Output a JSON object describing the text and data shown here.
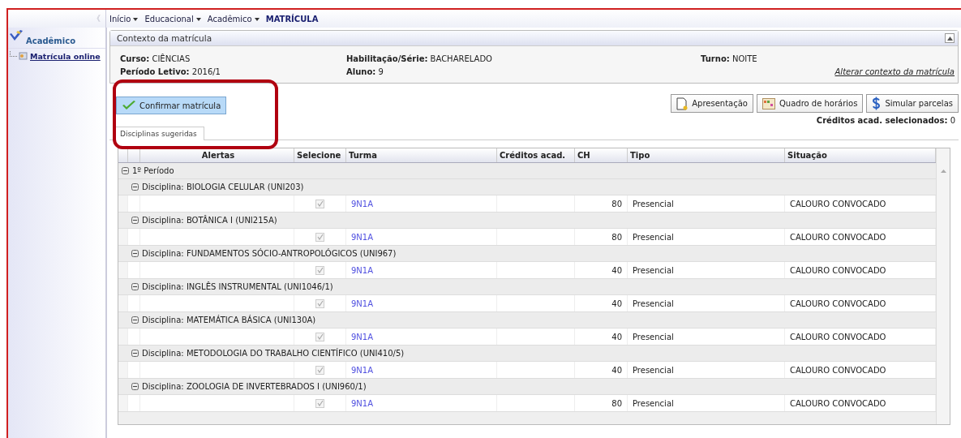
{
  "breadcrumb": [
    {
      "label": "Início",
      "dropdown": true
    },
    {
      "label": "Educacional",
      "dropdown": true
    },
    {
      "label": "Acadêmico",
      "dropdown": true
    },
    {
      "label": "MATRÍCULA",
      "dropdown": false
    }
  ],
  "sidebar": {
    "collapse": "《",
    "title": "Acadêmico",
    "items": [
      {
        "label": "Matrícula online",
        "selected": true
      }
    ]
  },
  "context": {
    "title": "Contexto da matrícula",
    "fields": [
      {
        "label": "Curso:",
        "value": "CIÊNCIAS"
      },
      {
        "label": "Habilitação/Série:",
        "value": "BACHARELADO"
      },
      {
        "label": "Turno:",
        "value": "NOITE"
      },
      {
        "label": "Período Letivo:",
        "value": "2016/1"
      },
      {
        "label": "Aluno:",
        "value": "9"
      }
    ],
    "link": "Alterar contexto da matrícula"
  },
  "confirm_button": "Confirmar matrícula",
  "actions": [
    {
      "kind": "presentation",
      "label": "Apresentação"
    },
    {
      "kind": "schedule",
      "label": "Quadro de horários"
    },
    {
      "kind": "money",
      "label": "Simular parcelas"
    }
  ],
  "credits": {
    "label": "Créditos acad. selecionados:",
    "value": "0"
  },
  "tabs": [
    {
      "label": "Disciplinas sugeridas",
      "selected": true
    }
  ],
  "table": {
    "columns": [
      "Alertas",
      "Selecione",
      "Turma",
      "Créditos acad.",
      "CH",
      "Tipo",
      "Situação"
    ],
    "group": {
      "label": "1º Período",
      "expanded": true
    },
    "sections": [
      {
        "label": "Disciplina: BIOLOGIA CELULAR (UNI203)",
        "expanded": true,
        "rows": [
          {
            "checked": true,
            "disabled": true,
            "turma": "9N1A",
            "ch": "80",
            "tipo": "Presencial",
            "situacao": "CALOURO CONVOCADO"
          }
        ]
      },
      {
        "label": "Disciplina: BOTÂNICA I (UNI215A)",
        "expanded": true,
        "rows": [
          {
            "checked": true,
            "disabled": true,
            "turma": "9N1A",
            "ch": "80",
            "tipo": "Presencial",
            "situacao": "CALOURO CONVOCADO"
          }
        ]
      },
      {
        "label": "Disciplina: FUNDAMENTOS SÓCIO-ANTROPOLÓGICOS (UNI967)",
        "expanded": true,
        "rows": [
          {
            "checked": true,
            "disabled": true,
            "turma": "9N1A",
            "ch": "40",
            "tipo": "Presencial",
            "situacao": "CALOURO CONVOCADO"
          }
        ]
      },
      {
        "label": "Disciplina: INGLÊS INSTRUMENTAL (UNI1046/1)",
        "expanded": true,
        "rows": [
          {
            "checked": true,
            "disabled": true,
            "turma": "9N1A",
            "ch": "40",
            "tipo": "Presencial",
            "situacao": "CALOURO CONVOCADO"
          }
        ]
      },
      {
        "label": "Disciplina: MATEMÁTICA BÁSICA (UNI130A)",
        "expanded": true,
        "rows": [
          {
            "checked": true,
            "disabled": true,
            "turma": "9N1A",
            "ch": "40",
            "tipo": "Presencial",
            "situacao": "CALOURO CONVOCADO"
          }
        ]
      },
      {
        "label": "Disciplina: METODOLOGIA DO TRABALHO CIENTÍFICO (UNI410/5)",
        "expanded": true,
        "rows": [
          {
            "checked": true,
            "disabled": true,
            "turma": "9N1A",
            "ch": "40",
            "tipo": "Presencial",
            "situacao": "CALOURO CONVOCADO"
          }
        ]
      },
      {
        "label": "Disciplina: ZOOLOGIA DE INVERTEBRADOS I (UNI960/1)",
        "expanded": true,
        "rows": [
          {
            "checked": true,
            "disabled": true,
            "turma": "9N1A",
            "ch": "80",
            "tipo": "Presencial",
            "situacao": "CALOURO CONVOCADO"
          }
        ]
      }
    ]
  }
}
